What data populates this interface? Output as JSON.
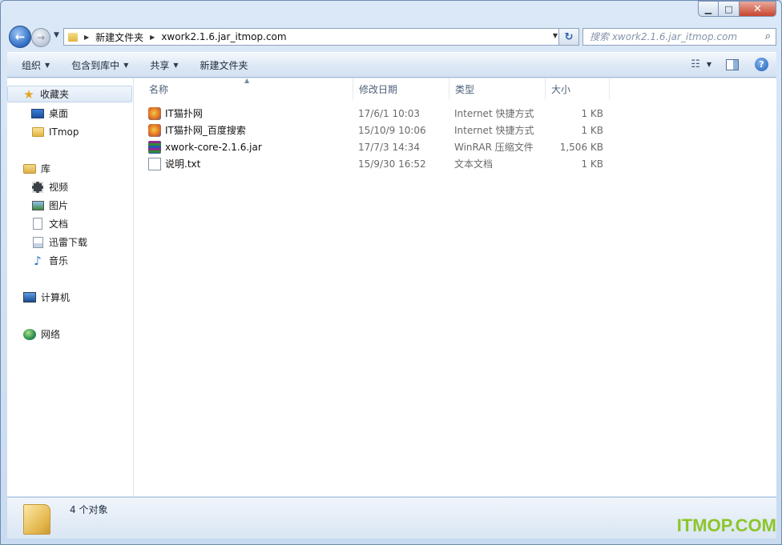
{
  "window": {
    "caption": {
      "minimize": "▁",
      "maximize": "□",
      "close": "✕"
    }
  },
  "address": {
    "crumbs": [
      "新建文件夹",
      "xwork2.1.6.jar_itmop.com"
    ]
  },
  "search": {
    "placeholder": "搜索 xwork2.1.6.jar_itmop.com"
  },
  "toolbar": {
    "organize": "组织",
    "include_in_library": "包含到库中",
    "share": "共享",
    "new_folder": "新建文件夹"
  },
  "sidebar": {
    "favorites": {
      "label": "收藏夹",
      "items": [
        {
          "label": "桌面"
        },
        {
          "label": "ITmop"
        }
      ]
    },
    "libraries": {
      "label": "库",
      "items": [
        {
          "label": "视频"
        },
        {
          "label": "图片"
        },
        {
          "label": "文档"
        },
        {
          "label": "迅雷下载"
        },
        {
          "label": "音乐"
        }
      ]
    },
    "computer": {
      "label": "计算机"
    },
    "network": {
      "label": "网络"
    }
  },
  "columns": {
    "name": "名称",
    "date": "修改日期",
    "type": "类型",
    "size": "大小"
  },
  "files": [
    {
      "name": "IT猫扑网",
      "date": "17/6/1 10:03",
      "type": "Internet 快捷方式",
      "size": "1 KB",
      "icon": "internet-shortcut-icon"
    },
    {
      "name": "IT猫扑网_百度搜索",
      "date": "15/10/9 10:06",
      "type": "Internet 快捷方式",
      "size": "1 KB",
      "icon": "internet-shortcut-icon"
    },
    {
      "name": "xwork-core-2.1.6.jar",
      "date": "17/7/3 14:34",
      "type": "WinRAR 压缩文件",
      "size": "1,506 KB",
      "icon": "winrar-archive-icon"
    },
    {
      "name": "说明.txt",
      "date": "15/9/30 16:52",
      "type": "文本文档",
      "size": "1 KB",
      "icon": "text-document-icon"
    }
  ],
  "status": {
    "count": "4 个对象"
  },
  "watermark": "ITMOP.COM"
}
